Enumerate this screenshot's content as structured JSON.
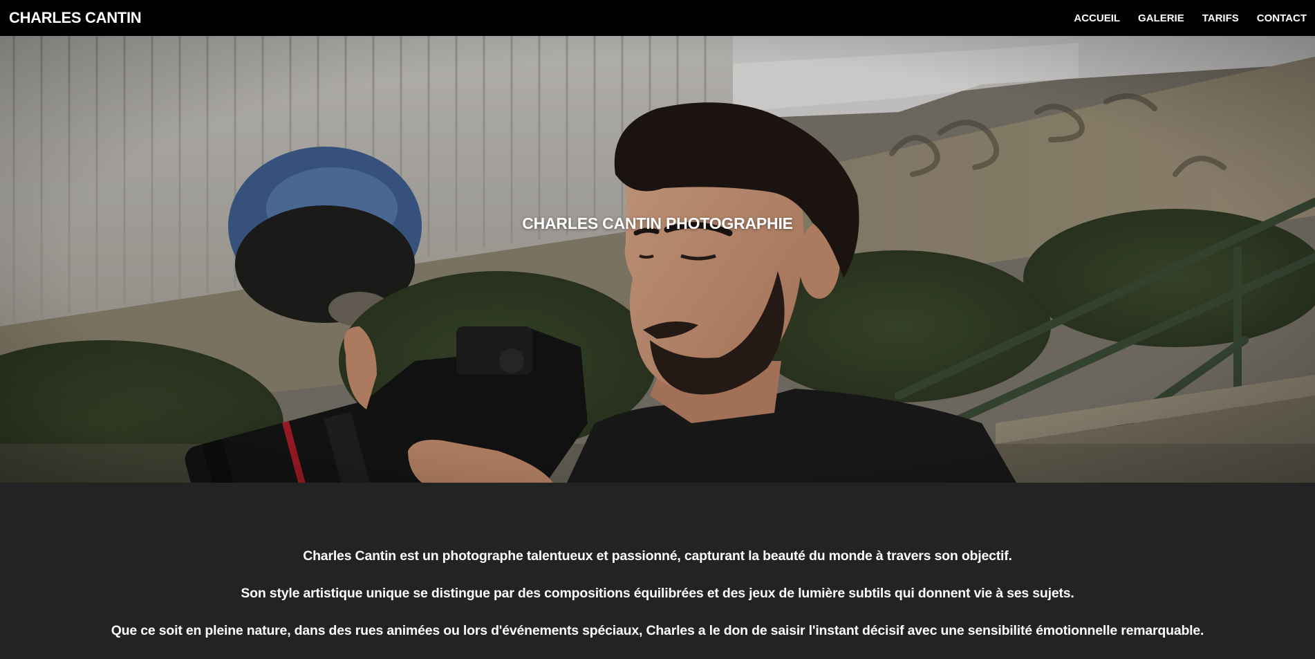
{
  "header": {
    "brand": "CHARLES CANTIN",
    "nav": [
      {
        "label": "ACCUEIL"
      },
      {
        "label": "GALERIE"
      },
      {
        "label": "TARIFS"
      },
      {
        "label": "CONTACT"
      }
    ]
  },
  "hero": {
    "title": "CHARLES CANTIN PHOTOGRAPHIE",
    "image_subject": "photographer-with-camera"
  },
  "about": {
    "paragraphs": [
      "Charles Cantin est un photographe talentueux et passionné, capturant la beauté du monde à travers son objectif.",
      "Son style artistique unique se distingue par des compositions équilibrées et des jeux de lumière subtils qui donnent vie à ses sujets.",
      "Que ce soit en pleine nature, dans des rues animées ou lors d'événements spéciaux, Charles a le don de saisir l'instant décisif avec une sensibilité émotionnelle remarquable."
    ]
  },
  "colors": {
    "header_bg": "#000000",
    "section_bg": "#232323",
    "text": "#ffffff"
  }
}
